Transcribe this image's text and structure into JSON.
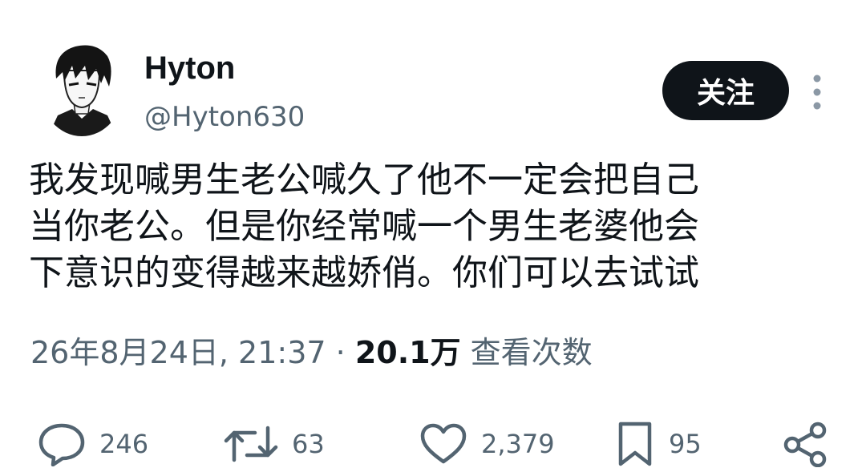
{
  "author": {
    "display_name": "Hyton",
    "handle": "@Hyton630",
    "avatar_icon": "anime-boy-avatar"
  },
  "follow_button": {
    "label": "关注"
  },
  "more_menu": {
    "icon": "vertical-ellipsis-icon"
  },
  "tweet": {
    "lines": [
      "我发现喊男生老公喊久了他不一定会把自己",
      "当你老公。但是你经常喊一个男生老婆他会",
      "下意识的变得越来越娇俏。你们可以去试试"
    ],
    "timestamp": "26年8月24日, 21:37",
    "separator": " · ",
    "views_count": "20.1万",
    "views_label": " 查看次数"
  },
  "actions": {
    "reply": {
      "icon": "reply-icon",
      "count": "246"
    },
    "retweet": {
      "icon": "retweet-icon",
      "count": "63"
    },
    "like": {
      "icon": "heart-icon",
      "count": "2,379"
    },
    "bookmark": {
      "icon": "bookmark-icon",
      "count": "95"
    },
    "share": {
      "icon": "share-icon"
    }
  },
  "colors": {
    "text_primary": "#0f1419",
    "text_secondary": "#536471",
    "button_bg": "#0f1419",
    "button_text": "#ffffff"
  }
}
